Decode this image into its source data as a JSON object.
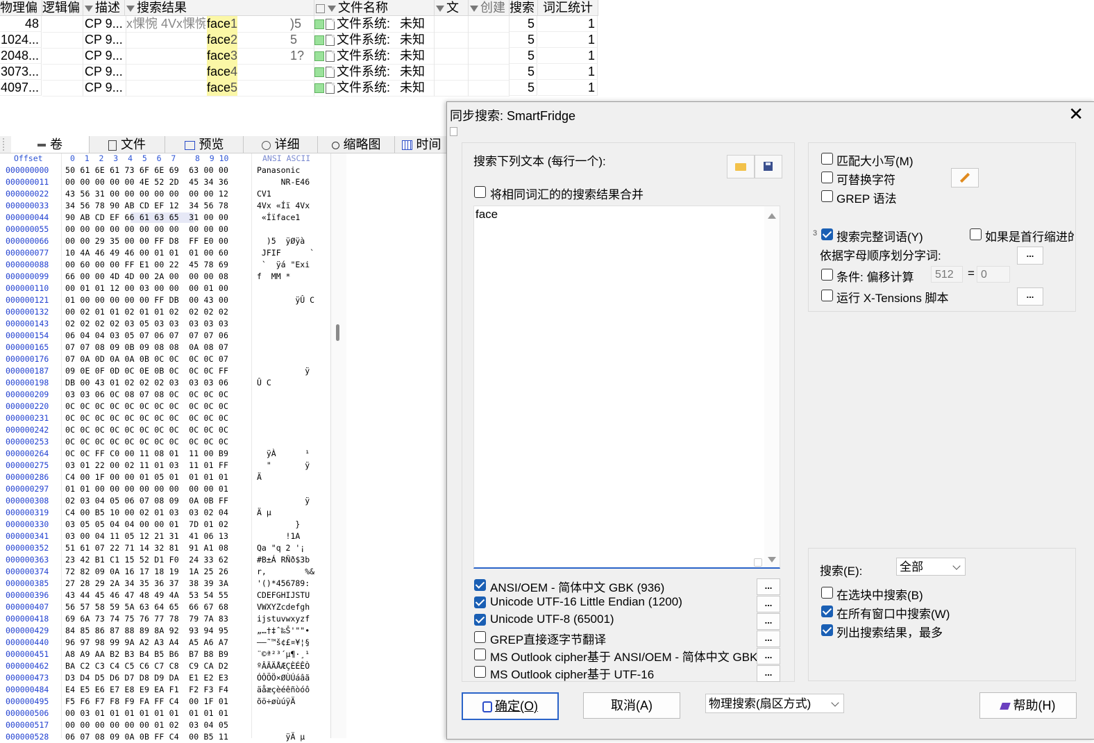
{
  "results": {
    "headers": [
      "物理偏",
      "逻辑偏",
      "描述",
      "搜索结果",
      "文件名称",
      "文",
      "创建",
      "搜索",
      "词汇统计"
    ],
    "rows": [
      {
        "phys": "48",
        "desc": "CP 9...",
        "pre": "x惈惋 4Vx惈惋",
        "hit": "face",
        "num": "1",
        "ctx": ")5",
        "fname": "文件系统:",
        "fstate": "未知",
        "search": "5",
        "count": "1"
      },
      {
        "phys": "1024...",
        "desc": "CP 9...",
        "pre": "",
        "hit": "face",
        "num": "2",
        "ctx": "5",
        "fname": "文件系统:",
        "fstate": "未知",
        "search": "5",
        "count": "1"
      },
      {
        "phys": "2048...",
        "desc": "CP 9...",
        "pre": "",
        "hit": "face",
        "num": "3",
        "ctx": "1?",
        "fname": "文件系统:",
        "fstate": "未知",
        "search": "5",
        "count": "1"
      },
      {
        "phys": "3073...",
        "desc": "CP 9...",
        "pre": "",
        "hit": "face",
        "num": "4",
        "ctx": "",
        "fname": "文件系统:",
        "fstate": "未知",
        "search": "5",
        "count": "1"
      },
      {
        "phys": "4097...",
        "desc": "CP 9...",
        "pre": "",
        "hit": "face",
        "num": "5",
        "ctx": "",
        "fname": "文件系统:",
        "fstate": "未知",
        "search": "5",
        "count": "1"
      }
    ]
  },
  "tabs": [
    "卷",
    "文件",
    "预览",
    "详细",
    "缩略图",
    "时间"
  ],
  "hex": {
    "header_offset": "Offset",
    "header_cols": "0  1  2  3  4  5  6  7    8  9 10",
    "header_text": "ANSI ASCII",
    "rows": [
      [
        "000000000",
        "50 61 6E 61 73 6F 6E 69  63 00 00",
        "Panasonic"
      ],
      [
        "000000011",
        "00 00 00 00 00 4E 52 2D  45 34 36",
        "     NR-E46"
      ],
      [
        "000000022",
        "43 56 31 00 00 00 00 00  00 00 12",
        "CV1"
      ],
      [
        "000000033",
        "34 56 78 90 AB CD EF 12  34 56 78",
        "4Vx «Íï 4Vx"
      ],
      [
        "000000044",
        "90 AB CD EF 66 61 63 65  31 00 00",
        " «Íïface1"
      ],
      [
        "000000055",
        "00 00 00 00 00 00 00 00  00 00 00",
        ""
      ],
      [
        "000000066",
        "00 00 29 35 00 00 FF D8  FF E0 00",
        "  )5  ÿØÿà"
      ],
      [
        "000000077",
        "10 4A 46 49 46 00 01 01  01 00 60",
        " JFIF      `"
      ],
      [
        "000000088",
        "00 60 00 00 FF E1 00 22  45 78 69",
        " `  ÿá \"Exi"
      ],
      [
        "000000099",
        "66 00 00 4D 4D 00 2A 00  00 00 08",
        "f  MM *"
      ],
      [
        "000000110",
        "00 01 01 12 00 03 00 00  00 01 00",
        ""
      ],
      [
        "000000121",
        "01 00 00 00 00 00 FF DB  00 43 00",
        "        ÿÛ C"
      ],
      [
        "000000132",
        "00 02 01 01 02 01 01 02  02 02 02",
        ""
      ],
      [
        "000000143",
        "02 02 02 02 03 05 03 03  03 03 03",
        ""
      ],
      [
        "000000154",
        "06 04 04 03 05 07 06 07  07 07 06",
        ""
      ],
      [
        "000000165",
        "07 07 08 09 0B 09 08 08  0A 08 07",
        ""
      ],
      [
        "000000176",
        "07 0A 0D 0A 0A 0B 0C 0C  0C 0C 07",
        ""
      ],
      [
        "000000187",
        "09 0E 0F 0D 0C 0E 0B 0C  0C 0C FF",
        "          ÿ"
      ],
      [
        "000000198",
        "DB 00 43 01 02 02 02 03  03 03 06",
        "Û C"
      ],
      [
        "000000209",
        "03 03 06 0C 08 07 08 0C  0C 0C 0C",
        ""
      ],
      [
        "000000220",
        "0C 0C 0C 0C 0C 0C 0C 0C  0C 0C 0C",
        ""
      ],
      [
        "000000231",
        "0C 0C 0C 0C 0C 0C 0C 0C  0C 0C 0C",
        ""
      ],
      [
        "000000242",
        "0C 0C 0C 0C 0C 0C 0C 0C  0C 0C 0C",
        ""
      ],
      [
        "000000253",
        "0C 0C 0C 0C 0C 0C 0C 0C  0C 0C 0C",
        ""
      ],
      [
        "000000264",
        "0C 0C FF C0 00 11 08 01  11 00 B9",
        "  ÿÀ      ¹"
      ],
      [
        "000000275",
        "03 01 22 00 02 11 01 03  11 01 FF",
        "  \"       ÿ"
      ],
      [
        "000000286",
        "C4 00 1F 00 00 01 05 01  01 01 01",
        "Ä"
      ],
      [
        "000000297",
        "01 01 00 00 00 00 00 00  00 00 01",
        ""
      ],
      [
        "000000308",
        "02 03 04 05 06 07 08 09  0A 0B FF",
        "          ÿ"
      ],
      [
        "000000319",
        "C4 00 B5 10 00 02 01 03  03 02 04",
        "Ä µ"
      ],
      [
        "000000330",
        "03 05 05 04 04 00 00 01  7D 01 02",
        "        }"
      ],
      [
        "000000341",
        "03 00 04 11 05 12 21 31  41 06 13",
        "      !1A"
      ],
      [
        "000000352",
        "51 61 07 22 71 14 32 81  91 A1 08",
        "Qa \"q 2 '¡"
      ],
      [
        "000000363",
        "23 42 B1 C1 15 52 D1 F0  24 33 62",
        "#B±Á RÑð$3b"
      ],
      [
        "000000374",
        "72 82 09 0A 16 17 18 19  1A 25 26",
        "r,        %&"
      ],
      [
        "000000385",
        "27 28 29 2A 34 35 36 37  38 39 3A",
        "'()*456789:"
      ],
      [
        "000000396",
        "43 44 45 46 47 48 49 4A  53 54 55",
        "CDEFGHIJSTU"
      ],
      [
        "000000407",
        "56 57 58 59 5A 63 64 65  66 67 68",
        "VWXYZcdefgh"
      ],
      [
        "000000418",
        "69 6A 73 74 75 76 77 78  79 7A 83",
        "ijstuvwxyzf"
      ],
      [
        "000000429",
        "84 85 86 87 88 89 8A 92  93 94 95",
        "„…†‡ˆ‰Š'\"\"•"
      ],
      [
        "000000440",
        "96 97 98 99 9A A2 A3 A4  A5 A6 A7",
        "–—˜™š¢£¤¥¦§"
      ],
      [
        "000000451",
        "A8 A9 AA B2 B3 B4 B5 B6  B7 B8 B9",
        "¨©ª²³´µ¶·¸¹"
      ],
      [
        "000000462",
        "BA C2 C3 C4 C5 C6 C7 C8  C9 CA D2",
        "ºÂÃÄÅÆÇÈÉÊÒ"
      ],
      [
        "000000473",
        "D3 D4 D5 D6 D7 D8 D9 DA  E1 E2 E3",
        "ÓÔÕÖ×ØÙÚáâã"
      ],
      [
        "000000484",
        "E4 E5 E6 E7 E8 E9 EA F1  F2 F3 F4",
        "äåæçèéêñòóô"
      ],
      [
        "000000495",
        "F5 F6 F7 F8 F9 FA FF C4  00 1F 01",
        "õö÷øùúÿÄ"
      ],
      [
        "000000506",
        "00 03 01 01 01 01 01 01  01 01 01",
        ""
      ],
      [
        "000000517",
        "00 00 00 00 00 00 01 02  03 04 05",
        ""
      ],
      [
        "000000528",
        "06 07 08 09 0A 0B FF C4  00 B5 11",
        "      ÿÄ µ"
      ]
    ]
  },
  "dialog": {
    "title": "同步搜索: SmartFridge",
    "close": "✕",
    "search_label": "搜索下列文本 (每行一个):",
    "merge_label": "将相同词汇的的搜索结果合并",
    "text": "face",
    "encodings": [
      {
        "label": "ANSI/OEM - 简体中文 GBK (936)",
        "checked": true
      },
      {
        "label": "Unicode UTF-16 Little Endian (1200)",
        "checked": true
      },
      {
        "label": "Unicode UTF-8 (65001)",
        "checked": true
      },
      {
        "label": "GREP直接逐字节翻译",
        "checked": false
      },
      {
        "label": "MS Outlook cipher基于 ANSI/OEM - 简体中文 GBK",
        "checked": false
      },
      {
        "label": "MS Outlook cipher基于 UTF-16",
        "checked": false
      }
    ],
    "dots": "...",
    "options": {
      "match_case": "匹配大小写(M)",
      "alt_chars": "可替换字符",
      "grep": "GREP 语法",
      "whole_word_prefix": "3",
      "whole_word": "搜索完整词语(Y)",
      "indent": "如果是首行缩进的",
      "alpha_split": "依据字母顺序划分字词:",
      "offset_cond": "条件: 偏移计算",
      "offset_val": "512",
      "eq": "=",
      "offset_res": "0",
      "xtension": "运行 X-Tensions 脚本"
    },
    "scope": {
      "search_label": "搜索(E):",
      "search_value": "全部",
      "in_block": "在选块中搜索(B)",
      "all_windows": "在所有窗口中搜索(W)",
      "list_results": "列出搜索结果，最多"
    },
    "buttons": {
      "ok": "确定(O)",
      "cancel": "取消(A)",
      "mode": "物理搜索(扇区方式)",
      "help": "帮助(H)"
    }
  }
}
